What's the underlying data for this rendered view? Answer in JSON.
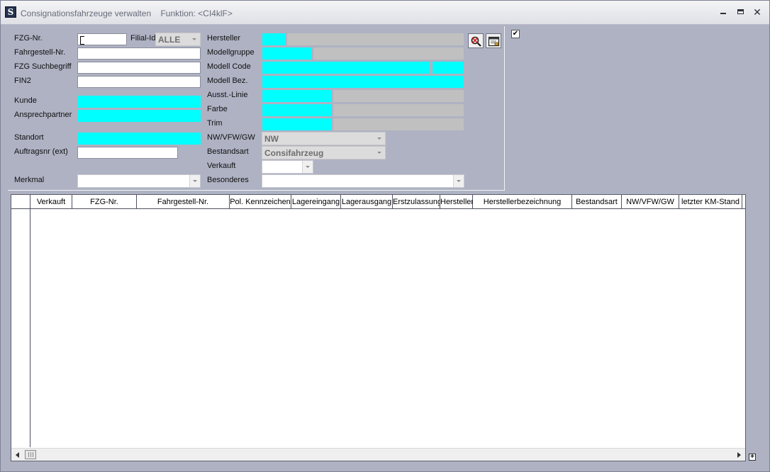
{
  "window": {
    "title": "Consignationsfahrzeuge verwalten",
    "function": "Funktion: <CI4klF>",
    "app_icon_letter": "S"
  },
  "form": {
    "labels": {
      "fzg_nr": "FZG-Nr.",
      "filial_id": "Filial-Id",
      "fahrgestell_nr": "Fahrgestell-Nr.",
      "fzg_suchbegriff": "FZG Suchbegriff",
      "fin2": "FIN2",
      "kunde": "Kunde",
      "ansprechpartner": "Ansprechpartner",
      "standort": "Standort",
      "auftragsnr": "Auftragsnr (ext)",
      "merkmal": "Merkmal",
      "hersteller": "Hersteller",
      "modellgruppe": "Modellgruppe",
      "modell_code": "Modell Code",
      "modell_bez": "Modell Bez.",
      "ausst_linie": "Ausst.-Linie",
      "farbe": "Farbe",
      "trim": "Trim",
      "nw_vfw_gw": "NW/VFW/GW",
      "bestandsart": "Bestandsart",
      "verkauft": "Verkauft",
      "besonderes": "Besonderes"
    },
    "values": {
      "fzg_nr": "",
      "filial_id": "ALLE",
      "fahrgestell_nr": "",
      "fzg_suchbegriff": "",
      "fin2": "",
      "auftragsnr": "",
      "merkmal": "",
      "nw_vfw_gw": "NW",
      "bestandsart": "Consifahrzeug",
      "verkauft": "",
      "besonderes": ""
    },
    "checkbox_checked": true,
    "checkbox_mark": "✔"
  },
  "grid": {
    "columns": [
      "Verkauft",
      "FZG-Nr.",
      "Fahrgestell-Nr.",
      "Pol. Kennzeichen",
      "Lagereingang",
      "Lagerausgang",
      "Erstzulassung",
      "Hersteller",
      "Herstellerbezeichnung",
      "Bestandsart",
      "NW/VFW/GW",
      "letzter KM-Stand"
    ],
    "resize_symbol": "+"
  },
  "colors": {
    "required_field": "#00ffff",
    "readonly_field": "#c0c0c0",
    "background": "#aeb2c3"
  }
}
